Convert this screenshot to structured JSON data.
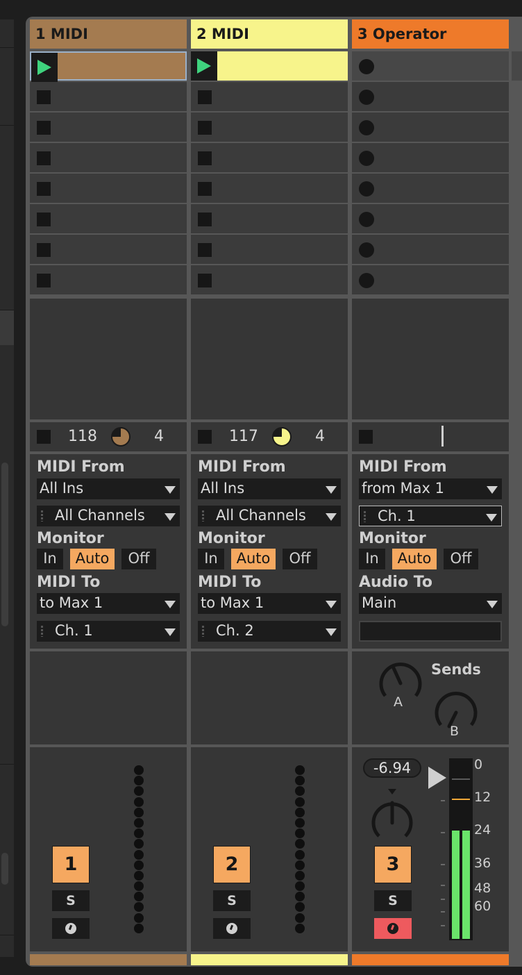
{
  "colors": {
    "track1": "#a47b50",
    "track2": "#f7f48b",
    "track3": "#ee7a2a",
    "accent": "#f5a860",
    "play": "#3fd37e",
    "arm_active": "#ee5a5e",
    "meter": "#6ae36a"
  },
  "tracks": [
    {
      "name": "1 MIDI",
      "tempo_left": "118",
      "tempo_right": "4",
      "io": {
        "from_label": "MIDI From",
        "from_value": "All Ins",
        "channel": "All Channels",
        "monitor_label": "Monitor",
        "monitor": [
          "In",
          "Auto",
          "Off"
        ],
        "to_label": "MIDI To",
        "to_value": "to Max 1",
        "to_channel": "Ch. 1"
      },
      "number": "1",
      "solo": "S"
    },
    {
      "name": "2 MIDI",
      "tempo_left": "117",
      "tempo_right": "4",
      "io": {
        "from_label": "MIDI From",
        "from_value": "All Ins",
        "channel": "All Channels",
        "monitor_label": "Monitor",
        "monitor": [
          "In",
          "Auto",
          "Off"
        ],
        "to_label": "MIDI To",
        "to_value": "to Max 1",
        "to_channel": "Ch. 2"
      },
      "number": "2",
      "solo": "S"
    },
    {
      "name": "3 Operator",
      "io": {
        "from_label": "MIDI From",
        "from_value": "from Max 1",
        "channel": "Ch. 1",
        "monitor_label": "Monitor",
        "monitor": [
          "In",
          "Auto",
          "Off"
        ],
        "to_label": "Audio To",
        "to_value": "Main",
        "to_channel": ""
      },
      "sends_label": "Sends",
      "send_a": "A",
      "send_b": "B",
      "volume": "-6.94",
      "meter_scale": [
        "0",
        "12",
        "24",
        "36",
        "48",
        "60"
      ],
      "meter_level": 0.61,
      "number": "3",
      "solo": "S"
    }
  ]
}
